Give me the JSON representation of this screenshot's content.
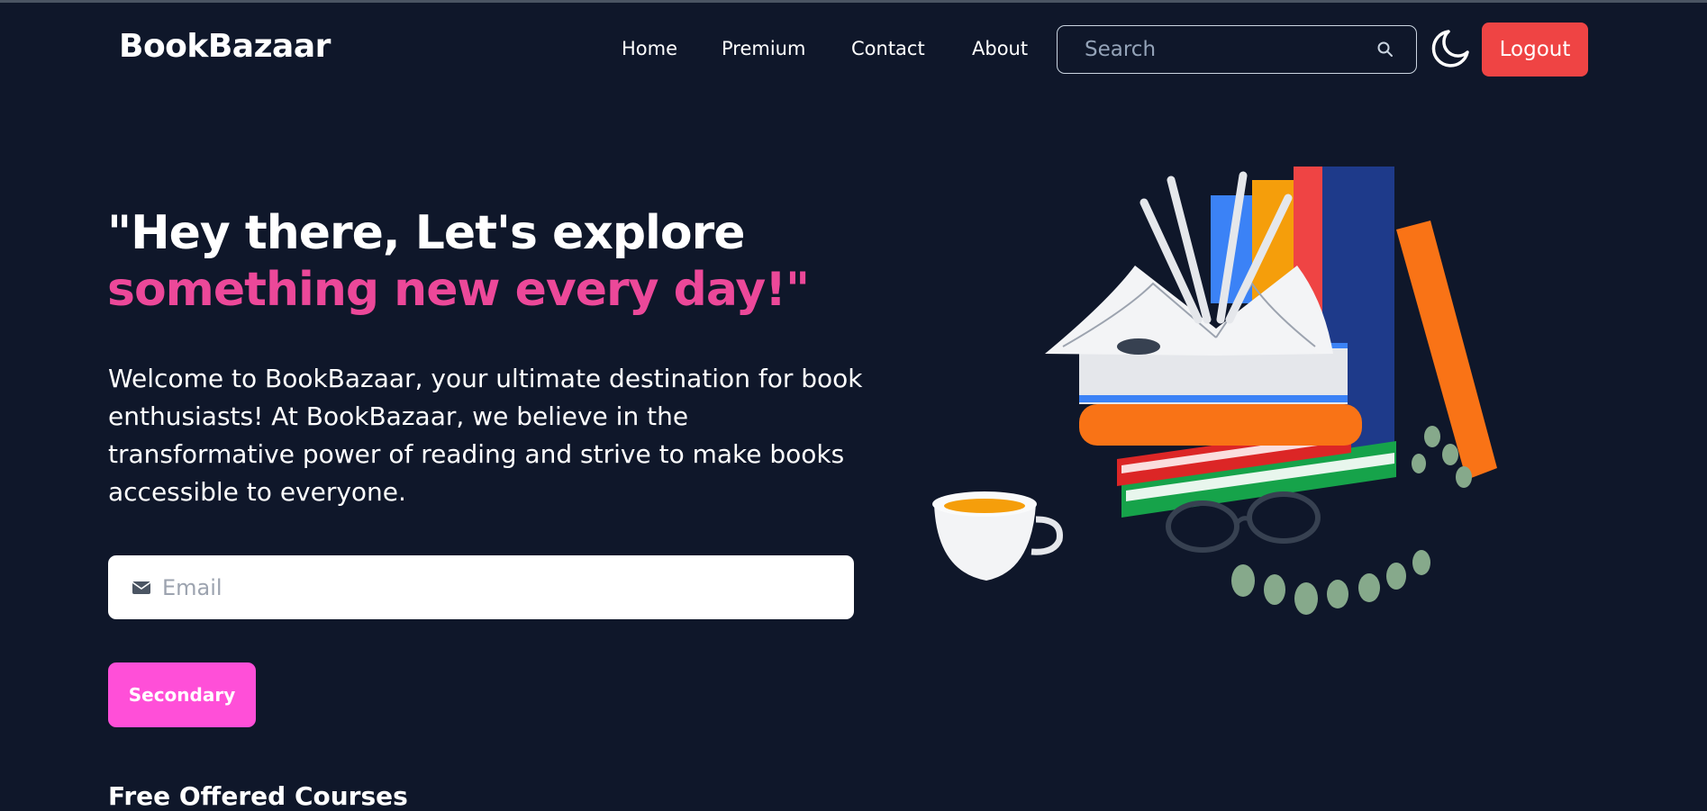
{
  "navbar": {
    "brand": "BookBazaar",
    "links": [
      "Home",
      "Premium",
      "Contact",
      "About"
    ],
    "search": {
      "placeholder": "Search",
      "icon": "search-icon"
    },
    "theme_toggle_icon": "moon-icon",
    "logout_label": "Logout"
  },
  "hero": {
    "title_line1": "\"Hey there, Let's explore",
    "title_line2": "something new every day!\"",
    "description": "Welcome to BookBazaar, your ultimate destination for book enthusiasts! At BookBazaar, we believe in the transformative power of reading and strive to make books accessible to everyone.",
    "email_placeholder": "Email",
    "email_icon": "envelope-icon",
    "secondary_label": "Secondary",
    "illustration": "books-stack-illustration"
  },
  "courses": {
    "heading": "Free Offered Courses"
  },
  "colors": {
    "background": "#0f172a",
    "accent_pink": "#ec4899",
    "button_pink": "#ff4fd8",
    "logout_red": "#ef4444"
  }
}
